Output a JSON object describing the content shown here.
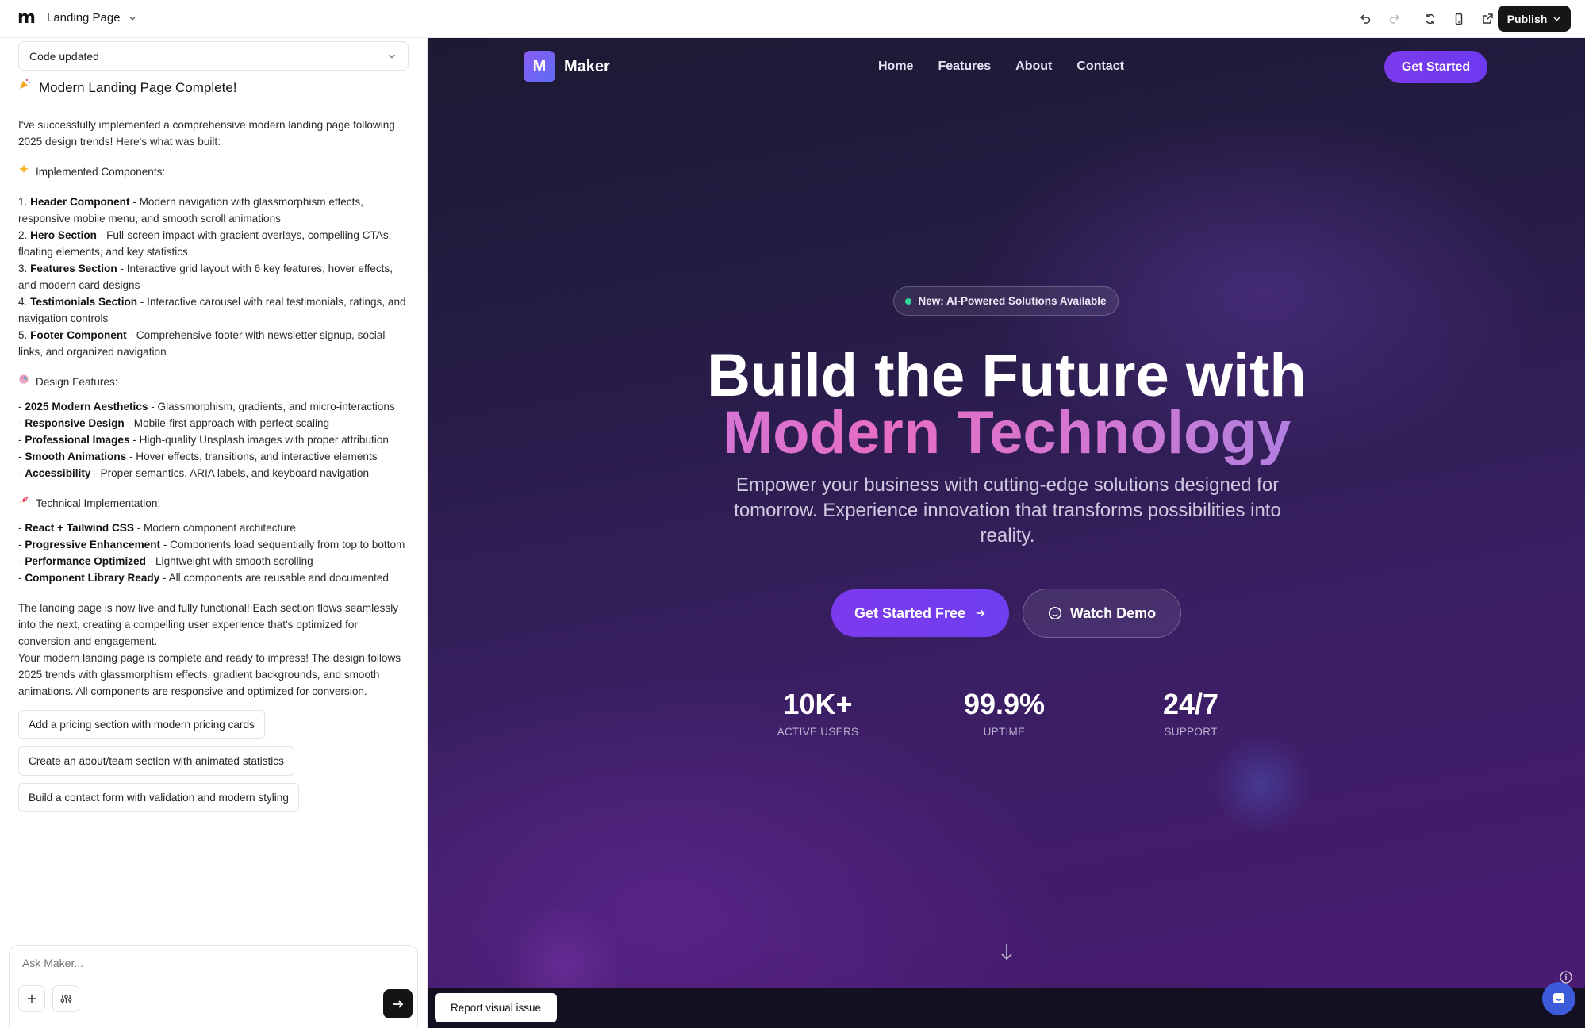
{
  "topbar": {
    "logo": "m",
    "project_title": "Landing Page",
    "publish_label": "Publish"
  },
  "chat": {
    "status_select": "Code updated",
    "title": "Modern Landing Page Complete!",
    "intro": "I've successfully implemented a comprehensive modern landing page following 2025 design trends! Here's what was built:",
    "components_heading": "Implemented Components:",
    "components": [
      {
        "prefix": "1. ",
        "name": "Header Component",
        "desc": " - Modern navigation with glassmorphism effects, responsive mobile menu, and smooth scroll animations"
      },
      {
        "prefix": "2. ",
        "name": "Hero Section",
        "desc": " - Full-screen impact with gradient overlays, compelling CTAs, floating elements, and key statistics"
      },
      {
        "prefix": "3. ",
        "name": "Features Section",
        "desc": " - Interactive grid layout with 6 key features, hover effects, and modern card designs"
      },
      {
        "prefix": "4. ",
        "name": "Testimonials Section",
        "desc": " - Interactive carousel with real testimonials, ratings, and navigation controls"
      },
      {
        "prefix": "5. ",
        "name": "Footer Component",
        "desc": " - Comprehensive footer with newsletter signup, social links, and organized navigation"
      }
    ],
    "design_heading": "Design Features:",
    "design": [
      {
        "prefix": "- ",
        "name": "2025 Modern Aesthetics",
        "desc": " - Glassmorphism, gradients, and micro-interactions"
      },
      {
        "prefix": "- ",
        "name": "Responsive Design",
        "desc": " - Mobile-first approach with perfect scaling"
      },
      {
        "prefix": "- ",
        "name": "Professional Images",
        "desc": " - High-quality Unsplash images with proper attribution"
      },
      {
        "prefix": "- ",
        "name": "Smooth Animations",
        "desc": " - Hover effects, transitions, and interactive elements"
      },
      {
        "prefix": "- ",
        "name": "Accessibility",
        "desc": " - Proper semantics, ARIA labels, and keyboard navigation"
      }
    ],
    "tech_heading": "Technical Implementation:",
    "tech": [
      {
        "prefix": "- ",
        "name": "React + Tailwind CSS",
        "desc": " - Modern component architecture"
      },
      {
        "prefix": "- ",
        "name": "Progressive Enhancement",
        "desc": " - Components load sequentially from top to bottom"
      },
      {
        "prefix": "- ",
        "name": "Performance Optimized",
        "desc": " - Lightweight with smooth scrolling"
      },
      {
        "prefix": "- ",
        "name": "Component Library Ready",
        "desc": " - All components are reusable and documented"
      }
    ],
    "outro1": "The landing page is now live and fully functional! Each section flows seamlessly into the next, creating a compelling user experience that's optimized for conversion and engagement.",
    "outro2": "Your modern landing page is complete and ready to impress! The design follows 2025 trends with glassmorphism effects, gradient backgrounds, and smooth animations. All components are responsive and optimized for conversion.",
    "suggestions": [
      "Add a pricing section with modern pricing cards",
      "Create an about/team section with animated statistics",
      "Build a contact form with validation and modern styling"
    ],
    "composer_placeholder": "Ask Maker..."
  },
  "preview": {
    "brand_letter": "M",
    "brand_name": "Maker",
    "nav": [
      "Home",
      "Features",
      "About",
      "Contact"
    ],
    "nav_cta": "Get Started",
    "badge": "New: AI-Powered Solutions Available",
    "headline_line1": "Build the Future with",
    "headline_line2": "Modern Technology",
    "subheadline": "Empower your business with cutting-edge solutions designed for tomorrow. Experience innovation that transforms possibilities into reality.",
    "cta_primary": "Get Started Free",
    "cta_secondary": "Watch Demo",
    "stats": [
      {
        "value": "10K+",
        "label": "ACTIVE USERS"
      },
      {
        "value": "99.9%",
        "label": "UPTIME"
      },
      {
        "value": "24/7",
        "label": "SUPPORT"
      }
    ],
    "report_label": "Report visual issue"
  },
  "colors": {
    "accent": "#7c3aed",
    "publish_bg": "#161616",
    "badge_dot": "#34d399"
  }
}
